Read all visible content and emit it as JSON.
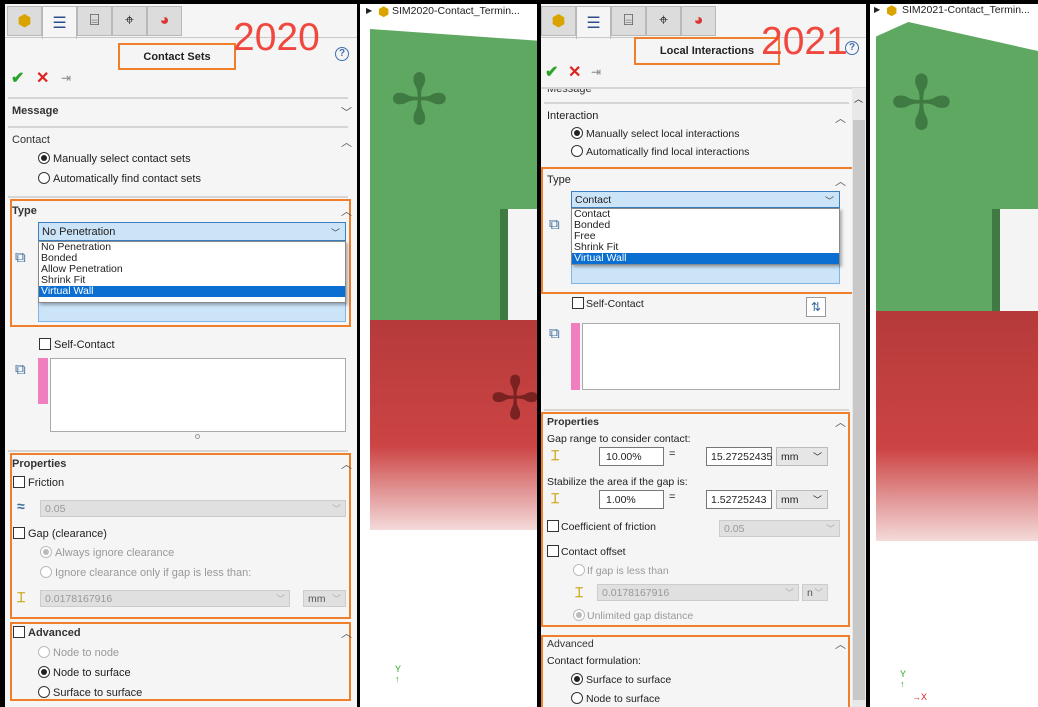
{
  "left": {
    "year": "2020",
    "title": "Contact Sets",
    "tabs": [
      "feature-manager",
      "property-manager",
      "configuration-manager",
      "dimxpert",
      "display-manager"
    ],
    "message_label": "Message",
    "contact_section": "Contact",
    "radio_manual": "Manually select contact sets",
    "radio_auto": "Automatically find contact sets",
    "type_section": "Type",
    "type_selected": "No Penetration",
    "type_options": [
      "No Penetration",
      "Bonded",
      "Allow Penetration",
      "Shrink Fit",
      "Virtual Wall"
    ],
    "self_contact": "Self-Contact",
    "properties_section": "Properties",
    "friction_label": "Friction",
    "friction_value": "0.05",
    "gap_label": "Gap (clearance)",
    "always_ignore": "Always ignore clearance",
    "ignore_only": "Ignore clearance only if gap is less than:",
    "gap_value": "0.0178167916",
    "gap_unit": "mm",
    "advanced_section": "Advanced",
    "node_to_node": "Node to node",
    "node_to_surface": "Node to surface",
    "surface_to_surface": "Surface to surface",
    "viewport_title": "SIM2020-Contact_Termin..."
  },
  "right": {
    "year": "2021",
    "title": "Local Interactions",
    "message_label": "Message",
    "interaction_section": "Interaction",
    "radio_manual": "Manually select local interactions",
    "radio_auto": "Automatically find local interactions",
    "type_section": "Type",
    "type_selected": "Contact",
    "type_options": [
      "Contact",
      "Bonded",
      "Free",
      "Shrink Fit",
      "Virtual Wall"
    ],
    "self_contact": "Self-Contact",
    "properties_section": "Properties",
    "gap_range_label": "Gap range to consider contact:",
    "gap_range_pct": "10.00%",
    "equals": "=",
    "gap_range_value": "15.27252435",
    "unit": "mm",
    "stabilize_label": "Stabilize the area if the gap is:",
    "stabilize_pct": "1.00%",
    "stabilize_value": "1.52725243",
    "coef_friction": "Coefficient of friction",
    "friction_value": "0.05",
    "contact_offset": "Contact offset",
    "if_gap_less": "If gap is less than",
    "offset_value": "0.0178167916",
    "offset_unit": "n",
    "unlimited_gap": "Unlimited gap distance",
    "advanced_section": "Advanced",
    "contact_formulation": "Contact formulation:",
    "surface_to_surface": "Surface to surface",
    "node_to_surface": "Node to surface",
    "viewport_title": "SIM2021-Contact_Termin..."
  },
  "colors": {
    "highlight": "#f07f2c",
    "year": "#f0473e",
    "selection": "#0a6fd1",
    "model_green": "#5fa862",
    "model_red": "#b63a3a"
  }
}
